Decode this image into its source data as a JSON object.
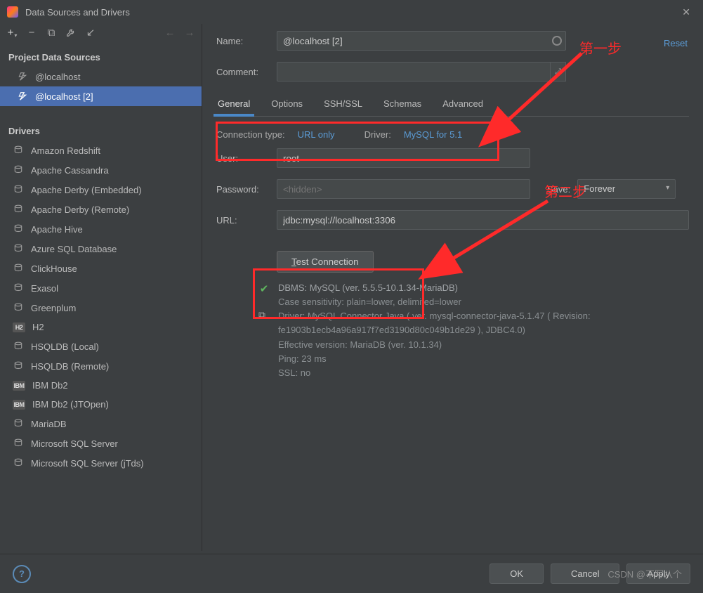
{
  "window": {
    "title": "Data Sources and Drivers"
  },
  "toolbar": {
    "add": "+",
    "remove": "−",
    "dup": "⧉",
    "wrench": "🔧",
    "revert": "↙",
    "back": "←",
    "fwd": "→"
  },
  "sidebar": {
    "sources_header": "Project Data Sources",
    "sources": [
      {
        "label": "@localhost"
      },
      {
        "label": "@localhost [2]"
      }
    ],
    "drivers_header": "Drivers",
    "drivers": [
      {
        "label": "Amazon Redshift",
        "icon": "db-icon"
      },
      {
        "label": "Apache Cassandra",
        "icon": "cassandra-icon"
      },
      {
        "label": "Apache Derby (Embedded)",
        "icon": "derby-icon"
      },
      {
        "label": "Apache Derby (Remote)",
        "icon": "derby-icon"
      },
      {
        "label": "Apache Hive",
        "icon": "hive-icon"
      },
      {
        "label": "Azure SQL Database",
        "icon": "azure-icon"
      },
      {
        "label": "ClickHouse",
        "icon": "clickhouse-icon"
      },
      {
        "label": "Exasol",
        "icon": "exasol-icon"
      },
      {
        "label": "Greenplum",
        "icon": "greenplum-icon"
      },
      {
        "label": "H2",
        "icon": "h2-icon",
        "txt": "H2"
      },
      {
        "label": "HSQLDB (Local)",
        "icon": "hsqldb-icon"
      },
      {
        "label": "HSQLDB (Remote)",
        "icon": "hsqldb-icon"
      },
      {
        "label": "IBM Db2",
        "icon": "db2-icon",
        "txt": "IBM"
      },
      {
        "label": "IBM Db2 (JTOpen)",
        "icon": "db2-icon",
        "txt": "IBM"
      },
      {
        "label": "MariaDB",
        "icon": "mariadb-icon"
      },
      {
        "label": "Microsoft SQL Server",
        "icon": "mssql-icon"
      },
      {
        "label": "Microsoft SQL Server (jTds)",
        "icon": "mssql-icon"
      }
    ]
  },
  "form": {
    "name_label": "Name:",
    "name_value": "@localhost [2]",
    "reset": "Reset",
    "comment_label": "Comment:",
    "tabs": [
      "General",
      "Options",
      "SSH/SSL",
      "Schemas",
      "Advanced"
    ],
    "conn_type_label": "Connection type:",
    "conn_type_value": "URL only",
    "driver_label": "Driver:",
    "driver_value": "MySQL for 5.1",
    "user_label": "User:",
    "user_value": "root",
    "password_label": "Password:",
    "password_placeholder": "<hidden>",
    "save_label": "Save:",
    "save_value": "Forever",
    "url_label": "URL:",
    "url_value": "jdbc:mysql://localhost:3306",
    "test_label_pre": "T",
    "test_label_post": "est Connection"
  },
  "result": {
    "dbms": "DBMS: MySQL (ver. 5.5.5-10.1.34-MariaDB)",
    "case": "Case sensitivity: plain=lower, delimited=lower",
    "driver": "Driver: MySQL Connector Java ( ver. mysql-connector-java-5.1.47 ( Revision: fe1903b1ecb4a96a917f7ed3190d80c049b1de29 ), JDBC4.0)",
    "eff": "Effective version: MariaDB (ver. 10.1.34)",
    "ping": "Ping: 23 ms",
    "ssl": "SSL: no"
  },
  "annotations": {
    "step1": "第一步",
    "step2": "第二步"
  },
  "footer": {
    "ok": "OK",
    "cancel": "Cancel",
    "apply": "Apply",
    "help": "?"
  },
  "watermark": "CSDN @不写八个"
}
